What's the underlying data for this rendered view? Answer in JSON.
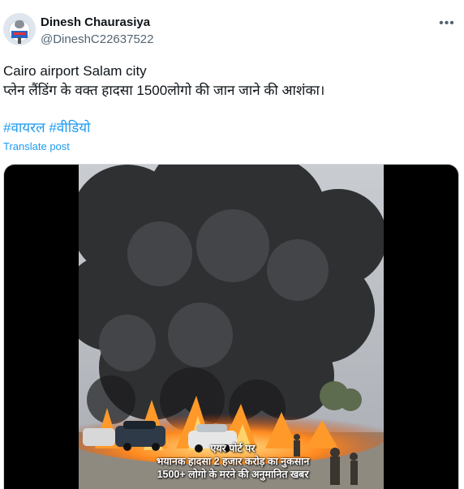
{
  "post": {
    "author_name": "Dinesh Chaurasiya",
    "author_handle": "@DineshC22637522",
    "more_icon": "ellipsis-icon",
    "text_line1": "Cairo airport Salam city",
    "text_line2": "प्लेन लैंडिंग के वक्त हादसा 1500लोगो की जान जाने की आशंका।",
    "hashtags": [
      "#वायरल",
      "#वीडियो"
    ],
    "translate_label": "Translate post"
  },
  "media": {
    "caption_line1": "एयर पोर्ट पर",
    "caption_line2": "भयानक हादसा 2 हजार करोड़ का नुकसान",
    "caption_line3": "1500+ लोगो के मरने की अनुमानित खबर"
  },
  "colors": {
    "link": "#1d9bf0",
    "secondary_text": "#536471",
    "smoke": "#3a3a3a",
    "fire": "#ff7a1a"
  }
}
